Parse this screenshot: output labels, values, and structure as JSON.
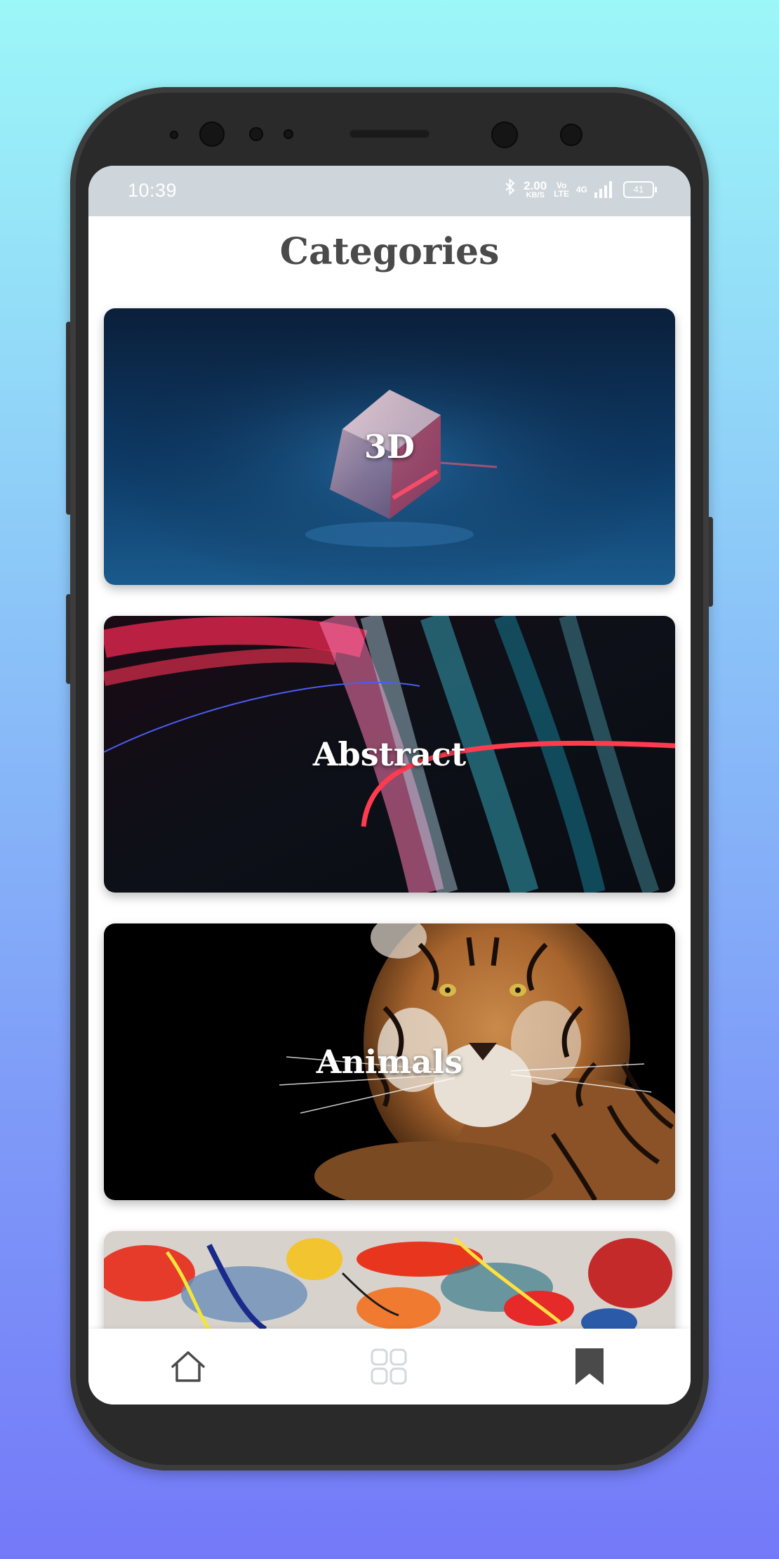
{
  "status_bar": {
    "time": "10:39",
    "speed_value": "2.00",
    "speed_unit": "KB/S",
    "volte_top": "Vo",
    "volte_bottom": "LTE",
    "network": "4G",
    "battery": "41"
  },
  "header": {
    "title": "Categories"
  },
  "categories": [
    {
      "label": "3D",
      "image": "glass-cube-image"
    },
    {
      "label": "Abstract",
      "image": "light-streaks-image"
    },
    {
      "label": "Animals",
      "image": "tiger-image"
    },
    {
      "label": "",
      "image": "paint-splash-image"
    }
  ],
  "bottom_nav": {
    "items": [
      {
        "icon": "home-icon",
        "active": false
      },
      {
        "icon": "grid-icon",
        "active": false
      },
      {
        "icon": "bookmark-icon",
        "active": true
      }
    ]
  },
  "colors": {
    "background_top": "#9cf7f8",
    "background_bottom": "#7479f8",
    "status_bar": "#cfd6db",
    "title_text": "#4a4a4a",
    "nav_active": "#4a4a4a",
    "nav_inactive": "#d4d8dc"
  }
}
